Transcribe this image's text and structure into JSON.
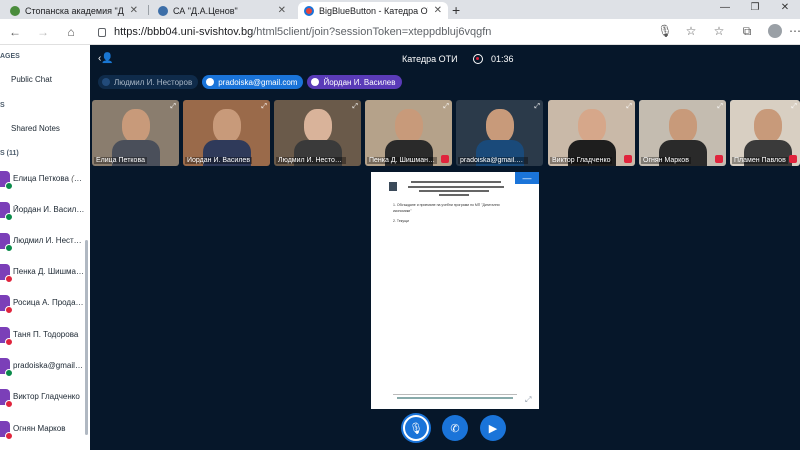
{
  "browser": {
    "tabs": [
      {
        "title": "Стопанска академия \"Димитър",
        "favicon_color": "#4a8c3c",
        "active": false
      },
      {
        "title": "СА \"Д.А.Ценов\"",
        "favicon_color": "#3c6ea8",
        "active": false
      },
      {
        "title": "BigBlueButton - Катедра ОТ",
        "favicon_color": "#e8453c",
        "active": true
      }
    ],
    "url_host": "https://bbb04.uni-svishtov.bg",
    "url_rest": "/html5client/join?sessionToken=xteppdbluj6vqgfn"
  },
  "sidebar": {
    "section_messages": "AGES",
    "public_chat": "Public Chat",
    "section_notes": "S",
    "shared_notes": "Shared Notes",
    "section_users": "S (11)",
    "users": [
      {
        "name": "Елица Петкова",
        "suffix": "(You)",
        "mic_color": "#0a8a4a"
      },
      {
        "name": "Йордан И. Василев",
        "suffix": "",
        "mic_color": "#0a8a4a"
      },
      {
        "name": "Людмил И. Несторов",
        "suffix": "",
        "mic_color": "#0a8a4a"
      },
      {
        "name": "Пенка Д. Шишманова",
        "suffix": "",
        "mic_color": "#e0243c"
      },
      {
        "name": "Росица А. Проданова",
        "suffix": "",
        "mic_color": "#e0243c"
      },
      {
        "name": "Таня П. Тодорова",
        "suffix": "",
        "mic_color": "#e0243c"
      },
      {
        "name": "pradoiska@gmail.com",
        "suffix": "",
        "mic_color": "#0a8a4a"
      },
      {
        "name": "Виктор Гладченко",
        "suffix": "",
        "mic_color": "#e0243c"
      },
      {
        "name": "Огнян Марков",
        "suffix": "",
        "mic_color": "#e0243c"
      }
    ]
  },
  "meeting": {
    "title": "Катедра ОТИ",
    "rec_time": "01:36",
    "talkers": [
      {
        "name": "Людмил И. Несторов",
        "state": "muted"
      },
      {
        "name": "pradoiska@gmail.com",
        "state": "active"
      },
      {
        "name": "Йордан И. Василев",
        "state": "purple"
      }
    ],
    "videos": [
      {
        "name": "Елица Петкова",
        "bg": "#8a7d6e",
        "shirt": "#4a4f5a",
        "muted": false
      },
      {
        "name": "Йордан И. Василев",
        "bg": "#9a6a4a",
        "shirt": "#2f3a5a",
        "muted": false
      },
      {
        "name": "Людмил И. Несторов",
        "bg": "#6a5a4a",
        "shirt": "#3a3a3a",
        "muted": false
      },
      {
        "name": "Пенка Д. Шишманова",
        "bg": "#b5a28a",
        "shirt": "#2a2a2a",
        "muted": true
      },
      {
        "name": "pradoiska@gmail.com",
        "bg": "#2b3a4a",
        "shirt": "#1a4a7a",
        "muted": false
      },
      {
        "name": "Виктор Гладченко",
        "bg": "#c9b9a8",
        "shirt": "#1e1e1e",
        "muted": true
      },
      {
        "name": "Огнян Марков",
        "bg": "#c4bcb0",
        "shirt": "#2a2a2a",
        "muted": true
      },
      {
        "name": "Пламен Павлов",
        "bg": "#d8cfc2",
        "shirt": "#3a3a3a",
        "muted": true
      }
    ],
    "presentation": {
      "line1": "1. Обсъждане и приемане на учебни програми по МП \"Дигитални икономики\"",
      "line2": "2. Текущи"
    }
  },
  "actions": {
    "mic_icon": "microphone-icon",
    "phone_icon": "phone-icon",
    "camera_icon": "video-camera-icon"
  }
}
